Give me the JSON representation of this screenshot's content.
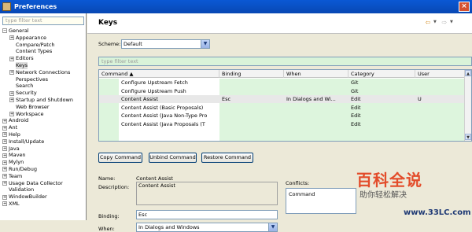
{
  "window": {
    "title": "Preferences"
  },
  "sidebar": {
    "filter_placeholder": "type filter text",
    "tree": [
      {
        "label": "General",
        "toggle": "−",
        "level": 0
      },
      {
        "label": "Appearance",
        "toggle": "+",
        "level": 1
      },
      {
        "label": "Compare/Patch",
        "toggle": "",
        "level": 1
      },
      {
        "label": "Content Types",
        "toggle": "",
        "level": 1
      },
      {
        "label": "Editors",
        "toggle": "+",
        "level": 1
      },
      {
        "label": "Keys",
        "toggle": "",
        "level": 1,
        "selected": true
      },
      {
        "label": "Network Connections",
        "toggle": "+",
        "level": 1
      },
      {
        "label": "Perspectives",
        "toggle": "",
        "level": 1
      },
      {
        "label": "Search",
        "toggle": "",
        "level": 1
      },
      {
        "label": "Security",
        "toggle": "+",
        "level": 1
      },
      {
        "label": "Startup and Shutdown",
        "toggle": "+",
        "level": 1
      },
      {
        "label": "Web Browser",
        "toggle": "",
        "level": 1
      },
      {
        "label": "Workspace",
        "toggle": "+",
        "level": 1
      },
      {
        "label": "Android",
        "toggle": "+",
        "level": 0
      },
      {
        "label": "Ant",
        "toggle": "+",
        "level": 0
      },
      {
        "label": "Help",
        "toggle": "+",
        "level": 0
      },
      {
        "label": "Install/Update",
        "toggle": "+",
        "level": 0
      },
      {
        "label": "Java",
        "toggle": "+",
        "level": 0
      },
      {
        "label": "Maven",
        "toggle": "+",
        "level": 0
      },
      {
        "label": "Mylyn",
        "toggle": "+",
        "level": 0
      },
      {
        "label": "Run/Debug",
        "toggle": "+",
        "level": 0
      },
      {
        "label": "Team",
        "toggle": "+",
        "level": 0
      },
      {
        "label": "Usage Data Collector",
        "toggle": "+",
        "level": 0
      },
      {
        "label": "Validation",
        "toggle": "",
        "level": 0
      },
      {
        "label": "WindowBuilder",
        "toggle": "+",
        "level": 0
      },
      {
        "label": "XML",
        "toggle": "+",
        "level": 0
      }
    ]
  },
  "page": {
    "title": "Keys",
    "scheme_label": "Scheme:",
    "scheme_value": "Default",
    "filter_placeholder": "type filter text",
    "columns": [
      "Command",
      "Binding",
      "When",
      "Category",
      "User"
    ],
    "rows": [
      [
        "Configure Upstream Fetch",
        "",
        "",
        "Git",
        ""
      ],
      [
        "Configure Upstream Push",
        "",
        "",
        "Git",
        ""
      ],
      [
        "Content Assist",
        "Esc",
        "In Dialogs and Wi...",
        "Edit",
        "U"
      ],
      [
        "Content Assist (Basic Proposals)",
        "",
        "",
        "Edit",
        ""
      ],
      [
        "Content Assist (Java Non-Type Pro",
        "",
        "",
        "Edit",
        ""
      ],
      [
        "Content Assist (Java Proposals (T",
        "",
        "",
        "Edit",
        ""
      ]
    ],
    "buttons": {
      "copy": "Copy Command",
      "unbind": "Unbind Command",
      "restore": "Restore Command"
    },
    "name_label": "Name:",
    "name_value": "Content Assist",
    "description_label": "Description:",
    "description_value": "Content Assist",
    "binding_label": "Binding:",
    "binding_value": "Esc",
    "when_label": "When:",
    "when_value": "In Dialogs and Windows",
    "conflicts_label": "Conflicts:",
    "conflicts_column": "Command"
  },
  "watermark": {
    "line1": "百科全说",
    "line2": "助你轻松解决",
    "line3": "www.33LC.com"
  },
  "colors": {
    "titlebar": "#0a58d4",
    "green_highlight": "#ddf5dd",
    "selected_row": "#e8e8e8"
  }
}
